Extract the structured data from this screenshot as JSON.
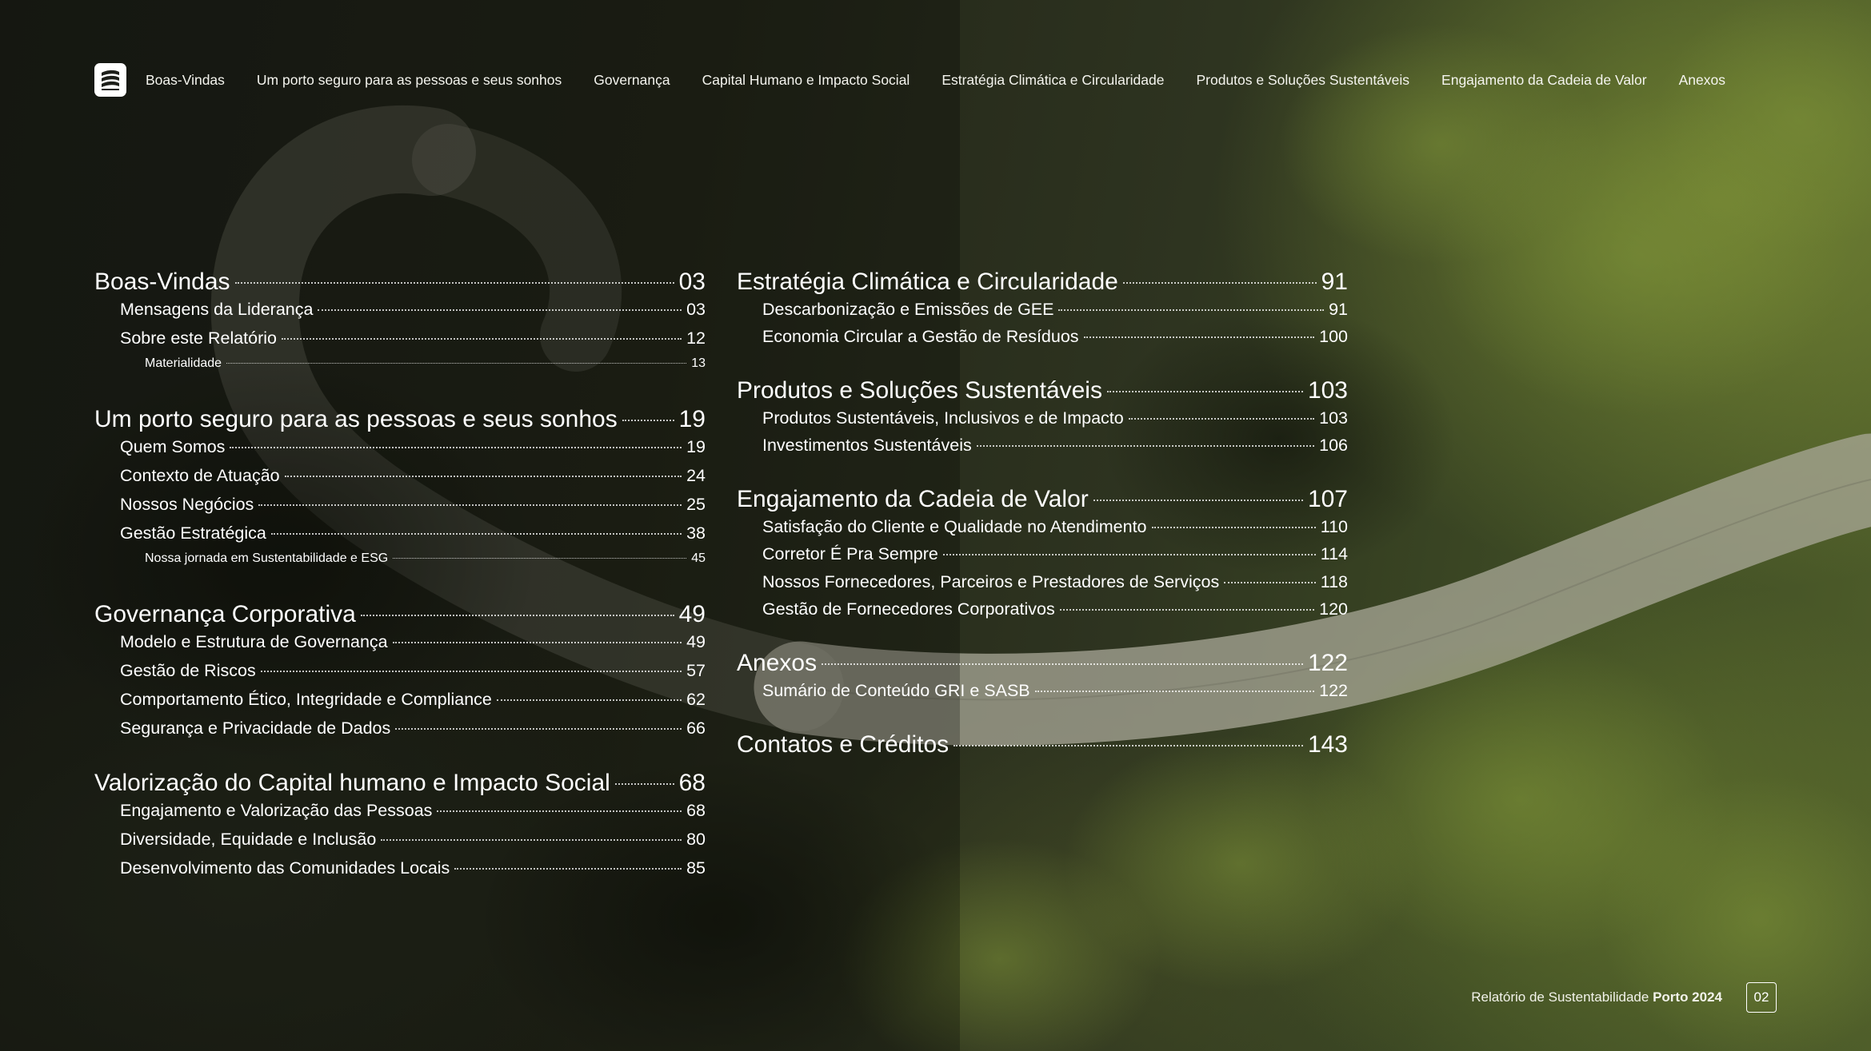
{
  "nav": {
    "items": [
      "Boas-Vindas",
      "Um porto seguro para as pessoas e seus sonhos",
      "Governança",
      "Capital Humano e Impacto Social",
      "Estratégia Climática e Circularidade",
      "Produtos e Soluções Sustentáveis",
      "Engajamento da Cadeia de Valor",
      "Anexos"
    ]
  },
  "toc_left": [
    {
      "title": "Boas-Vindas",
      "page": "03"
    },
    {
      "title": "Mensagens da Liderança",
      "page": "03"
    },
    {
      "title": "Sobre este Relatório",
      "page": "12"
    },
    {
      "title": "Materialidade",
      "page": "13"
    },
    {
      "title": "Um porto seguro para as pessoas e seus sonhos",
      "page": "19"
    },
    {
      "title": "Quem Somos",
      "page": "19"
    },
    {
      "title": "Contexto de Atuação",
      "page": "24"
    },
    {
      "title": "Nossos Negócios",
      "page": "25"
    },
    {
      "title": "Gestão Estratégica",
      "page": "38"
    },
    {
      "title": "Nossa jornada em Sustentabilidade e ESG",
      "page": "45"
    },
    {
      "title": "Governança Corporativa",
      "page": "49"
    },
    {
      "title": "Modelo e Estrutura de Governança",
      "page": "49"
    },
    {
      "title": "Gestão de Riscos",
      "page": "57"
    },
    {
      "title": "Comportamento Ético, Integridade e Compliance",
      "page": "62"
    },
    {
      "title": "Segurança e Privacidade de Dados",
      "page": "66"
    },
    {
      "title": "Valorização do Capital humano e Impacto Social",
      "page": "68"
    },
    {
      "title": "Engajamento e Valorização das Pessoas",
      "page": "68"
    },
    {
      "title": "Diversidade, Equidade e Inclusão",
      "page": "80"
    },
    {
      "title": "Desenvolvimento das Comunidades Locais",
      "page": "85"
    }
  ],
  "toc_right": [
    {
      "title": "Estratégia Climática e Circularidade",
      "page": "91"
    },
    {
      "title": "Descarbonização e Emissões de GEE",
      "page": "91"
    },
    {
      "title": "Economia Circular a Gestão de Resíduos",
      "page": "100"
    },
    {
      "title": "Produtos e Soluções Sustentáveis",
      "page": "103"
    },
    {
      "title": "Produtos Sustentáveis, Inclusivos e de Impacto",
      "page": "103"
    },
    {
      "title": "Investimentos Sustentáveis",
      "page": "106"
    },
    {
      "title": "Engajamento da Cadeia de Valor",
      "page": "107"
    },
    {
      "title": "Satisfação do Cliente e Qualidade no Atendimento",
      "page": "110"
    },
    {
      "title": "Corretor É Pra Sempre",
      "page": "114"
    },
    {
      "title": "Nossos Fornecedores, Parceiros e Prestadores de Serviços",
      "page": "118"
    },
    {
      "title": "Gestão de Fornecedores Corporativos",
      "page": "120"
    },
    {
      "title": "Anexos",
      "page": "122"
    },
    {
      "title": "Sumário de Conteúdo GRI e SASB",
      "page": "122"
    },
    {
      "title": "Contatos e Créditos",
      "page": "143"
    }
  ],
  "footer": {
    "report_label": "Relatório de Sustentabilidade",
    "report_bold": "Porto 2024",
    "page_number": "02"
  },
  "colors": {
    "text": "#ffffff",
    "forest_dark": "#1c1f17",
    "forest_light": "#4f5e2a",
    "road": "#b9b8a8"
  }
}
